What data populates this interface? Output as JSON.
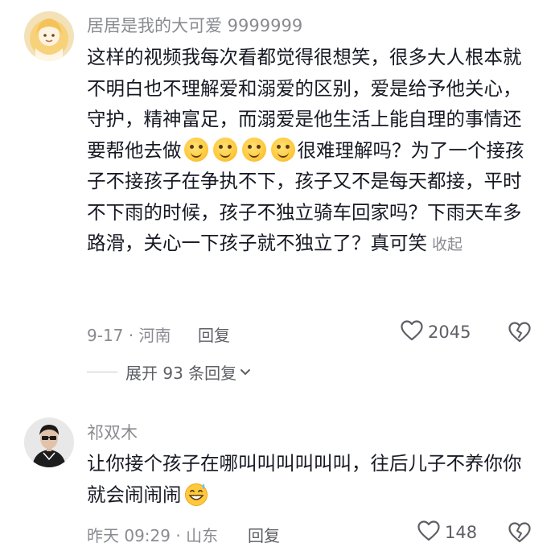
{
  "comments": [
    {
      "username": "居居是我的大可爱 9999999",
      "text_part1": "这样的视频我每次看都觉得很想笑，很多大人根本就不明白也不理解爱和溺爱的区别，爱是给予他关心，守护，精神富足，而溺爱是他生活上能自理的事情还要帮他去做",
      "text_part2": "很难理解吗？为了一个接孩子不接孩子在争执不下，孩子又不是每天都接，平时不下雨的时候，孩子不独立骑车回家吗？下雨天车多路滑，关心一下孩子就不独立了？真可笑",
      "collapse_label": "收起",
      "date_location": "9-17 · 河南",
      "reply_label": "回复",
      "like_count": "2045",
      "expand_label": "展开 93 条回复"
    },
    {
      "username": "祁双木",
      "text": "让你接个孩子在哪叫叫叫叫叫叫，往后儿子不养你你就会闹闹闹",
      "date_location": "昨天 09:29 · 山东",
      "reply_label": "回复",
      "like_count": "148"
    }
  ],
  "icons": {
    "like": "heart-outline-icon",
    "dislike": "broken-heart-icon",
    "expand": "chevron-down-icon",
    "emoji_smile": "smiling-face-emoji",
    "emoji_sweat": "grinning-sweat-emoji"
  },
  "colors": {
    "text": "#161823",
    "secondary": "#8a8b91",
    "action": "#5e5f66"
  }
}
